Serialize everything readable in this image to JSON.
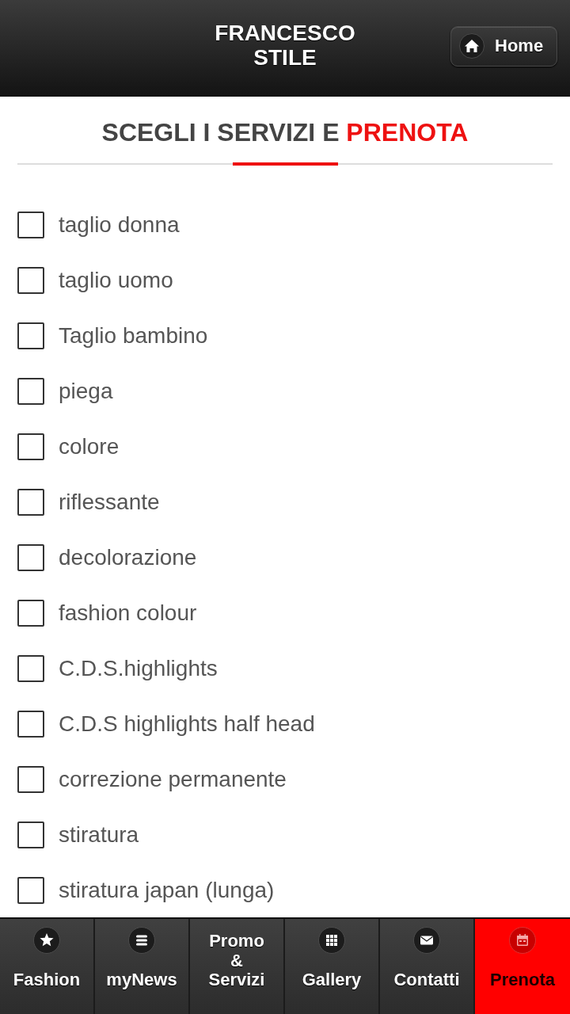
{
  "header": {
    "title": "FRANCESCO STILE",
    "home_button": "Home"
  },
  "section": {
    "title": "SCEGLI I SERVIZI E",
    "title_highlight": "PRENOTA"
  },
  "services": [
    {
      "label": "taglio donna",
      "checked": false
    },
    {
      "label": "taglio uomo",
      "checked": false
    },
    {
      "label": "Taglio bambino",
      "checked": false
    },
    {
      "label": "piega",
      "checked": false
    },
    {
      "label": "colore",
      "checked": false
    },
    {
      "label": "riflessante",
      "checked": false
    },
    {
      "label": "decolorazione",
      "checked": false
    },
    {
      "label": "fashion colour",
      "checked": false
    },
    {
      "label": "C.D.S.highlights",
      "checked": false
    },
    {
      "label": "C.D.S highlights half head",
      "checked": false
    },
    {
      "label": "correzione permanente",
      "checked": false
    },
    {
      "label": "stiratura",
      "checked": false
    },
    {
      "label": "stiratura japan (lunga)",
      "checked": false
    }
  ],
  "tabs": [
    {
      "label": "Fashion",
      "kind": "icon",
      "selected": false
    },
    {
      "label": "myNews",
      "kind": "icon",
      "selected": false
    },
    {
      "label": "Promo\n&\nServizi",
      "kind": "text",
      "selected": false
    },
    {
      "label": "Gallery",
      "kind": "icon",
      "selected": false
    },
    {
      "label": "Contatti",
      "kind": "icon",
      "selected": false
    },
    {
      "label": "Prenota",
      "kind": "icon",
      "selected": true
    }
  ]
}
